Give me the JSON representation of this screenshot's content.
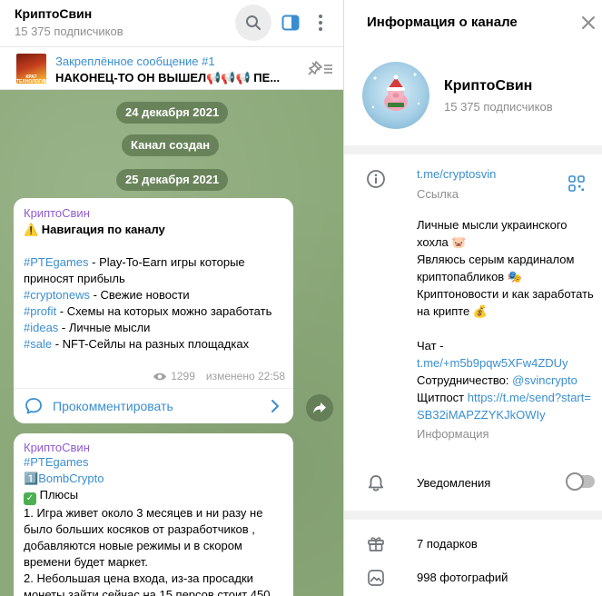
{
  "chat": {
    "title": "КриптоСвин",
    "subscribers": "15 375 подписчиков",
    "icons": {
      "search": "search-icon",
      "sidebar": "sidebar-toggle-icon",
      "more": "more-vertical-icon"
    }
  },
  "pinned": {
    "title": "Закреплённое сообщение #1",
    "text": "НАКОНЕЦ-ТО ОН ВЫШЕЛ📢📢📢 ПЕ...",
    "thumb_text": "КРАТ ТЕХНОЛОГИИ",
    "icon": "unpin-list-icon"
  },
  "dates": {
    "d1": "24 декабря 2021",
    "created": "Канал создан",
    "d2": "25 декабря 2021"
  },
  "msg1": {
    "author": "КриптоСвин",
    "title": "⚠️ Навигация по каналу",
    "lines": [
      {
        "tag": "#PTEgames",
        "text": " - Play-To-Earn игры которые приносят прибыль"
      },
      {
        "tag": "#cryptonews",
        "text": " - Свежие новости"
      },
      {
        "tag": "#profit",
        "text": " - Схемы на которых можно заработать"
      },
      {
        "tag": "#ideas",
        "text": " - Личные мысли"
      },
      {
        "tag": "#sale",
        "text": " - NFT-Сейлы на разных площадках"
      }
    ],
    "views": "1299",
    "edited": "изменено 22:58",
    "comment_label": "Прокомментировать"
  },
  "msg2": {
    "author": "КриптоСвин",
    "tag": "#PTEgames",
    "numbered": "1️⃣",
    "game_tag": "BombCrypto",
    "pros_label": "Плюсы",
    "body": "1. Игра живет около 3 месяцев и ни разу не было больших косяков от разработчиков , добавляются новые режимы и в скором времени будет маркет.",
    "body2": "2. Небольшая цена входа, из-за просадки монеты зайти сейчас на 15 персов стоит 450"
  },
  "info": {
    "title": "Информация о канале",
    "channel_name": "КриптоСвин",
    "subscribers": "15 375 подписчиков",
    "link": "t.me/cryptosvin",
    "link_caption": "Ссылка",
    "desc_lines": [
      {
        "text": "Личные мысли украинского хохла 🐷"
      },
      {
        "text": "Являюсь серым кардиналом криптопабликов 🎭"
      },
      {
        "text": "Криптоновости и как заработать на крипте 💰"
      }
    ],
    "chat_label": "Чат -",
    "chat_link": "t.me/+m5b9pqw5XFw4ZDUy",
    "coop_label": "Сотрудничество: ",
    "coop_link": "@svincrypto",
    "tip_label": "Щитпост ",
    "tip_link": "https://t.me/send?start=SB32iMAPZZYKJkOWIy",
    "info_caption": "Информация",
    "notifications": "Уведомления",
    "notifications_on": false,
    "gifts": "7 подарков",
    "photos": "998 фотографий"
  },
  "colors": {
    "accent": "#3a8ed0",
    "author": "#8e5bcf",
    "chat_bg": "#8ba979",
    "muted": "#8e8e8e"
  }
}
